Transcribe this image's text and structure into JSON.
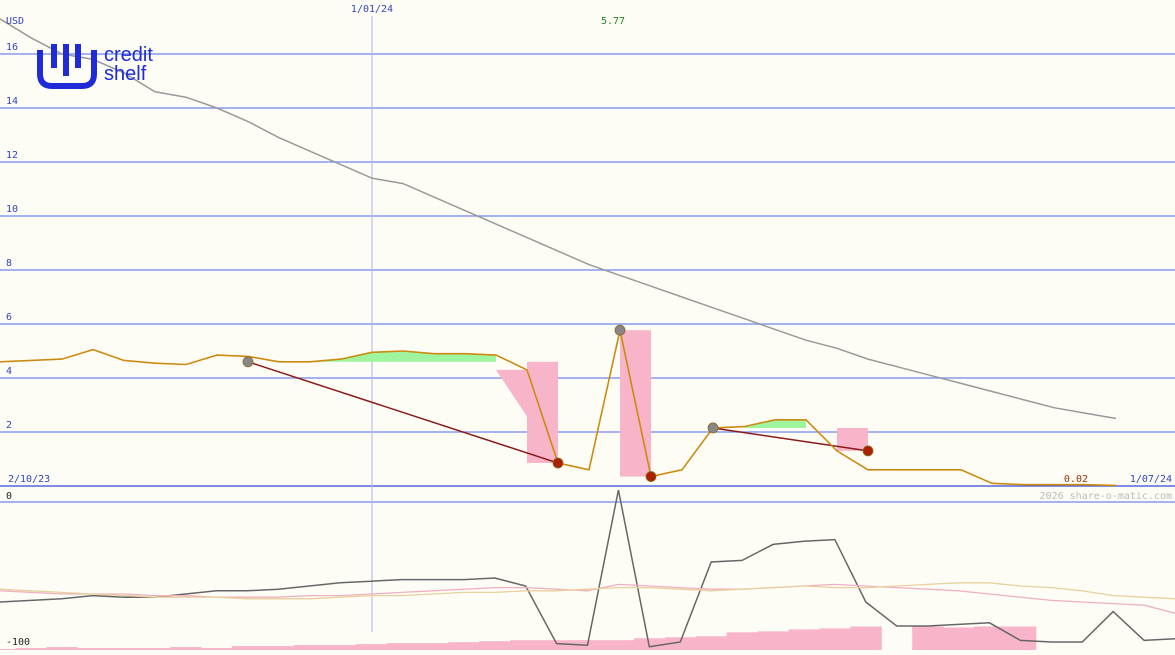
{
  "logo": {
    "line1": "credit",
    "line2": "shelf",
    "color": "#1e2bd6"
  },
  "header": {
    "unit": "USD",
    "marker_date": "1/01/24",
    "peak_value": "5.77",
    "start_date": "2/10/23",
    "end_date": "1/07/24",
    "last_value": "0.02",
    "watermark": "2026 share-o-matic.com"
  },
  "colors": {
    "price": "#cc8a10",
    "sma": "#999999",
    "trend": "#8a1a1a",
    "gain_fill": "#9ef59e",
    "loss_fill": "#f8b4c8",
    "grid": "#8899ee",
    "osc": "#666666",
    "osc_slow": "#f0b0c0",
    "osc_tan": "#e8d0a0",
    "hist": "#f8b4c8",
    "peak_text": "#228822",
    "last_text": "#993300"
  },
  "chart_data": [
    {
      "type": "line",
      "ylabel": "USD",
      "ylim": [
        0,
        16
      ],
      "yticks": [
        2,
        4,
        6,
        8,
        10,
        12,
        14,
        16
      ],
      "grid": true,
      "series": [
        {
          "values": [
            4.6,
            4.65,
            4.7,
            5.05,
            4.65,
            4.55,
            4.5,
            4.85,
            4.8,
            4.6,
            4.6,
            4.7,
            4.95,
            5.0,
            4.9,
            4.9,
            4.85,
            4.3,
            0.85,
            0.6,
            5.77,
            0.35,
            0.6,
            2.15,
            2.2,
            2.45,
            2.45,
            1.3,
            0.6,
            0.6,
            0.6,
            0.6,
            0.1,
            0.05,
            0.05,
            0.05,
            0.02
          ]
        },
        {
          "values": [
            17.3,
            16.6,
            16.0,
            15.8,
            15.3,
            14.6,
            14.4,
            14.0,
            13.5,
            12.9,
            12.4,
            11.9,
            11.4,
            11.2,
            10.7,
            10.2,
            9.7,
            9.2,
            8.7,
            8.2,
            7.8,
            7.4,
            7.0,
            6.6,
            6.2,
            5.8,
            5.4,
            5.1,
            4.7,
            4.4,
            4.1,
            3.8,
            3.5,
            3.2,
            2.9,
            2.7,
            2.5
          ]
        }
      ],
      "trend_points": [
        [
          8,
          4.6
        ],
        [
          18,
          0.85
        ],
        [
          21,
          0.35
        ],
        [
          23,
          2.15
        ],
        [
          28,
          1.3
        ],
        [
          20,
          5.77
        ]
      ]
    },
    {
      "type": "line",
      "ylim": [
        -100,
        0
      ],
      "ytick_labels": [
        "-100",
        "0"
      ],
      "series": [
        {
          "values": [
            -70,
            -69,
            -68,
            -66,
            -67,
            -67,
            -65,
            -63,
            -63,
            -62,
            -60,
            -58,
            -57,
            -56,
            -56,
            -56,
            -55,
            -60,
            -96,
            -97,
            0,
            -98,
            -95,
            -45,
            -44,
            -34,
            -32,
            -31,
            -70,
            -85,
            -85,
            -84,
            -83,
            -94,
            -95,
            -95,
            -76,
            -94,
            -93
          ]
        },
        {
          "values": [
            -63,
            -64,
            -65,
            -65,
            -65,
            -66,
            -66,
            -67,
            -67,
            -67,
            -66,
            -66,
            -65,
            -64,
            -63,
            -62,
            -61,
            -61,
            -62,
            -63,
            -59,
            -60,
            -61,
            -62,
            -62,
            -61,
            -60,
            -59,
            -60,
            -61,
            -62,
            -63,
            -65,
            -67,
            -69,
            -70,
            -71,
            -72,
            -77
          ]
        },
        {
          "values": [
            -62,
            -63,
            -64,
            -65,
            -66,
            -67,
            -67,
            -67,
            -68,
            -68,
            -68,
            -67,
            -66,
            -66,
            -65,
            -64,
            -64,
            -63,
            -63,
            -62,
            -61,
            -61,
            -62,
            -63,
            -62,
            -61,
            -60,
            -61,
            -61,
            -60,
            -59,
            -58,
            -58,
            -60,
            -61,
            -63,
            -66,
            -67,
            -68
          ]
        },
        {
          "values": [
            -25,
            -24,
            -23,
            -24,
            -24,
            -24,
            -23,
            -24,
            -22,
            -22,
            -21,
            -21,
            -20,
            -19,
            -19,
            -18,
            -17,
            -16,
            -16,
            -16,
            -16,
            -14,
            -13,
            -12,
            -8,
            -7,
            -5,
            -4,
            -2,
            -1,
            -2,
            -3,
            -2,
            -2,
            -1,
            -1,
            -1,
            -1,
            -1
          ]
        }
      ]
    }
  ]
}
